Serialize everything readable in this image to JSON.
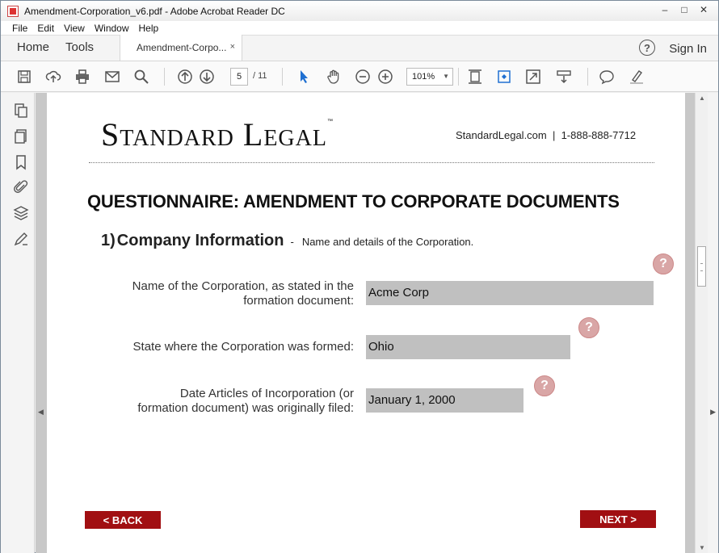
{
  "window": {
    "title": "Amendment-Corporation_v6.pdf - Adobe Acrobat Reader DC",
    "controls": [
      "–",
      "□",
      "✕"
    ]
  },
  "menu": [
    "File",
    "Edit",
    "View",
    "Window",
    "Help"
  ],
  "tabs": {
    "home": "Home",
    "tools": "Tools",
    "document": "Amendment-Corpo...",
    "close": "×",
    "help_icon": "?",
    "sign_in": "Sign In"
  },
  "toolbar": {
    "page_current": "5",
    "page_total": "/ 11",
    "zoom": "101%",
    "icons": [
      "save-icon",
      "upload-icon",
      "print-icon",
      "email-icon",
      "search-icon",
      "page-up-icon",
      "page-down-icon",
      "select-arrow-icon",
      "hand-icon",
      "zoom-out-icon",
      "zoom-in-icon",
      "fit-page-icon",
      "rotate-icon",
      "fullscreen-icon",
      "read-mode-icon",
      "comment-icon",
      "highlight-icon"
    ]
  },
  "left_panel_icons": [
    "export-pages-icon",
    "page-thumbnails-icon",
    "bookmark-icon",
    "attachment-icon",
    "layers-icon",
    "signature-icon"
  ],
  "document": {
    "logo": "Standard Legal",
    "logo_tm": "™",
    "contact": "StandardLegal.com  |  1-888-888-7712",
    "questionnaire_title": "QUESTIONNAIRE: AMENDMENT TO CORPORATE DOCUMENTS",
    "section": {
      "number": "1)",
      "name": "Company Information",
      "dash": "-",
      "description": "Name and details of the Corporation."
    },
    "fields": [
      {
        "label_line1": "Name of the Corporation, as stated in the",
        "label_line2": "formation document:",
        "value": "Acme Corp"
      },
      {
        "label_line1": "State where the Corporation was formed:",
        "label_line2": "",
        "value": "Ohio"
      },
      {
        "label_line1": "Date Articles of Incorporation (or",
        "label_line2": "formation document) was originally filed:",
        "value": "January 1, 2000"
      }
    ],
    "help_mark": "?",
    "back_label": "< BACK",
    "next_label": "NEXT >"
  },
  "colors": {
    "button_red": "#a10f12",
    "input_gray": "#c0c0c0",
    "help_pink": "#d9a6a6",
    "acrobat_blue": "#1f6fd1"
  }
}
